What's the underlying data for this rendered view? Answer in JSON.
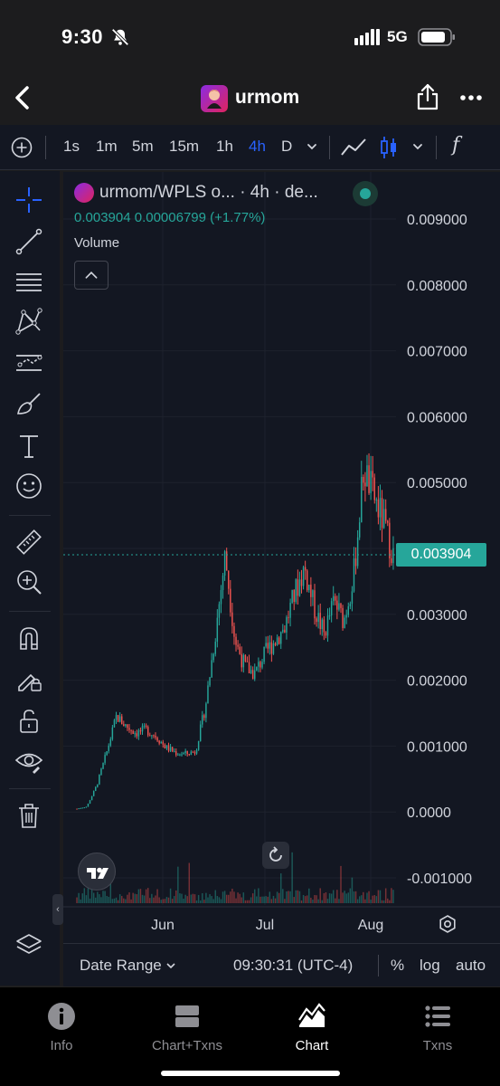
{
  "status_bar": {
    "time": "9:30",
    "network": "5G"
  },
  "header": {
    "title": "urmom"
  },
  "toolbar": {
    "timeframes": [
      "1s",
      "1m",
      "5m",
      "15m",
      "1h",
      "4h",
      "D"
    ],
    "active_timeframe": "4h",
    "fx_label": "f"
  },
  "chart_panel": {
    "legend_title": "urmom/WPLS o... · 4h · de...",
    "ohlc_text": "0.003904  0.00006799 (+1.77%)",
    "volume_label": "Volume",
    "last_price_tag": "0.003904"
  },
  "bottom_bar": {
    "date_range": "Date Range",
    "clock": "09:30:31 (UTC-4)",
    "percent": "%",
    "log": "log",
    "auto": "auto"
  },
  "tabs": [
    {
      "label": "Info",
      "icon": "info-icon"
    },
    {
      "label": "Chart+Txns",
      "icon": "split-view-icon"
    },
    {
      "label": "Chart",
      "icon": "chart-icon",
      "active": true
    },
    {
      "label": "Txns",
      "icon": "list-icon"
    }
  ],
  "colors": {
    "up": "#26a69a",
    "down": "#ef5350",
    "accent": "#2962ff",
    "background": "#131722"
  },
  "chart_data": {
    "type": "candlestick",
    "y_ticks": [
      "0.009000",
      "0.008000",
      "0.007000",
      "0.006000",
      "0.005000",
      "0.004000",
      "0.003000",
      "0.002000",
      "0.001000",
      "0.0000",
      "-0.001000"
    ],
    "x_ticks": [
      "Jun",
      "Jul",
      "Aug"
    ],
    "ylim": [
      -0.001,
      0.009
    ],
    "last_price": 0.003904,
    "series": [
      {
        "name": "close",
        "values": [
          5e-05,
          8e-05,
          0.0004,
          0.0009,
          0.00145,
          0.0013,
          0.0012,
          0.00125,
          0.00115,
          0.00098,
          0.0009,
          0.00088,
          0.00092,
          0.0016,
          0.0027,
          0.0039,
          0.0026,
          0.0022,
          0.0021,
          0.0024,
          0.0026,
          0.0028,
          0.0033,
          0.0037,
          0.0031,
          0.0027,
          0.0032,
          0.0029,
          0.0036,
          0.0052,
          0.0048,
          0.0044,
          0.0039
        ]
      }
    ]
  }
}
